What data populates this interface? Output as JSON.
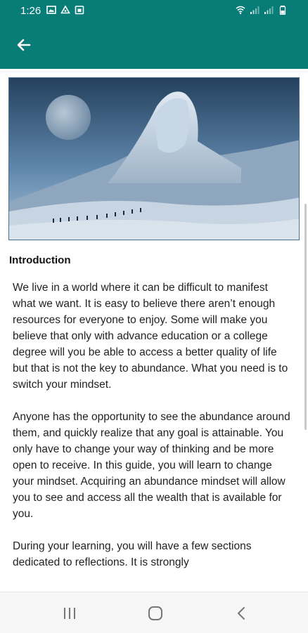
{
  "status_bar": {
    "time": "1:26",
    "left_icons": [
      "image-icon",
      "drive-icon",
      "calendar-icon"
    ],
    "right_icons": [
      "wifi-icon",
      "signal-icon",
      "signal-icon",
      "battery-icon"
    ]
  },
  "app_bar": {
    "back_icon": "arrow-left-icon",
    "color": "#087d78"
  },
  "article": {
    "section_title": "Introduction",
    "paragraphs": [
      "We live in a world where it can be difficult to manifest what we want. It is easy to believe there aren’t enough resources for everyone to enjoy. Some will make you believe that only with advance education or a college degree will you be able to access a better quality of life but that is not the key to abundance. What you need is to switch your mindset.",
      "Anyone has the opportunity to see the abundance around them, and quickly realize that any goal is attainable. You only have to change your way of thinking and be more open to receive. In this guide, you will learn to change your mindset. Acquiring an abundance mindset will allow you to see and access all the wealth that is available for you.",
      "During your learning, you will have a few sections dedicated to reflections. It is strongly"
    ]
  },
  "nav_bar": {
    "icons": [
      "recent-apps-icon",
      "home-icon",
      "back-icon"
    ]
  }
}
